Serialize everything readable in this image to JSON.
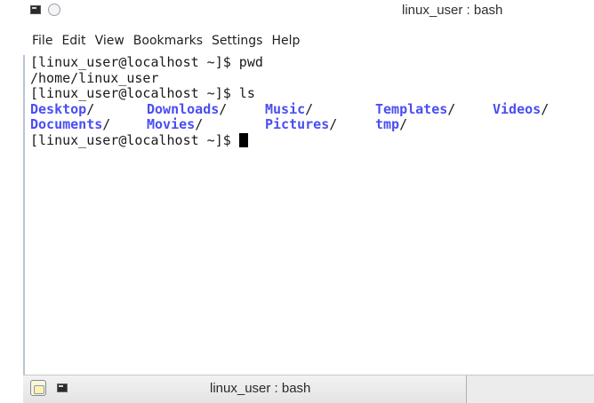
{
  "window": {
    "title": "linux_user : bash",
    "icon": "terminal-icon",
    "menu_button_icon": "window-menu-icon"
  },
  "menubar": {
    "items": [
      {
        "label": "File"
      },
      {
        "label": "Edit"
      },
      {
        "label": "View"
      },
      {
        "label": "Bookmarks"
      },
      {
        "label": "Settings"
      },
      {
        "label": "Help"
      }
    ]
  },
  "terminal": {
    "lines": [
      "[linux_user@localhost ~]$ pwd",
      "/home/linux_user",
      "[linux_user@localhost ~]$ ls"
    ],
    "ls_output": [
      [
        "Desktop",
        "Downloads",
        "Music",
        "Templates",
        "Videos"
      ],
      [
        "Documents",
        "Movies",
        "Pictures",
        "tmp"
      ]
    ],
    "dir_suffix": "/",
    "prompt": "[linux_user@localhost ~]$ ",
    "colors": {
      "text": "#1a1a1a",
      "directory": "#4a4ef2",
      "background": "#ffffff"
    }
  },
  "taskbar": {
    "launcher_icon": "launcher-icon",
    "task_icon": "terminal-icon",
    "task_title": "linux_user : bash"
  }
}
